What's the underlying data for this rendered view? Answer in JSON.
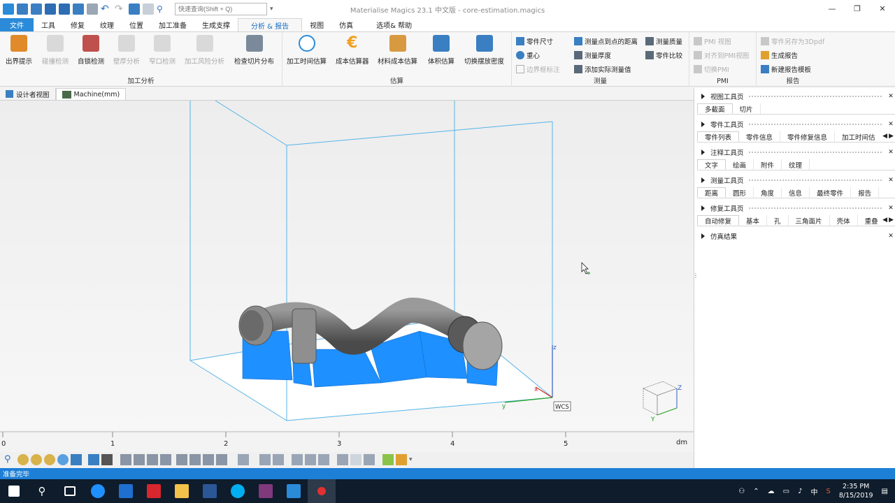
{
  "title": "Materialise Magics 23.1 中文版 - core-estimation.magics",
  "search_placeholder": "快速查询(Shift + Q)",
  "window_controls": [
    "—",
    "❐",
    "✕"
  ],
  "menu_tabs": [
    {
      "label": "文件",
      "kind": "file"
    },
    {
      "label": "工具"
    },
    {
      "label": "修复"
    },
    {
      "label": "纹理"
    },
    {
      "label": "位置"
    },
    {
      "label": "加工准备"
    },
    {
      "label": "生成支撑"
    },
    {
      "label": "分析 & 报告",
      "kind": "active"
    },
    {
      "label": "视图"
    },
    {
      "label": "仿真"
    },
    {
      "label": "选项& 帮助"
    }
  ],
  "ribbon": {
    "groups": [
      {
        "label": "加工分析"
      },
      {
        "label": "估算"
      },
      {
        "label": "测量"
      },
      {
        "label": "PMI"
      },
      {
        "label": "报告"
      }
    ],
    "big_buttons": [
      {
        "label": "出界提示",
        "icon": "out-of-bounds-icon",
        "color": "#e08a2a",
        "enabled": true
      },
      {
        "label": "碰撞检测",
        "icon": "collision-icon",
        "color": "#bdbdbd",
        "enabled": false
      },
      {
        "label": "自锁检测",
        "icon": "self-lock-icon",
        "color": "#c0504d",
        "enabled": true
      },
      {
        "label": "壁厚分析",
        "icon": "wall-thickness-icon",
        "color": "#bdbdbd",
        "enabled": false
      },
      {
        "label": "窄口检测",
        "icon": "narrow-gap-icon",
        "color": "#bdbdbd",
        "enabled": false
      },
      {
        "label": "加工风险分析",
        "icon": "risk-analysis-icon",
        "color": "#bdbdbd",
        "enabled": false
      },
      {
        "label": "检查切片分布",
        "icon": "slice-distribution-icon",
        "color": "#7a8a9a",
        "enabled": true
      },
      {
        "label": "加工时间估算",
        "icon": "clock-icon",
        "color": "#2b8bd9",
        "enabled": true
      },
      {
        "label": "成本估算器",
        "icon": "euro-icon",
        "color": "#f0a020",
        "enabled": true
      },
      {
        "label": "材料成本估算",
        "icon": "material-cost-icon",
        "color": "#d89a40",
        "enabled": true
      },
      {
        "label": "体积估算",
        "icon": "volume-estimate-icon",
        "color": "#3a7fc2",
        "enabled": true
      },
      {
        "label": "切换摆放密度",
        "icon": "packing-density-icon",
        "color": "#3a7fc2",
        "enabled": true
      }
    ],
    "small_buttons": [
      {
        "label": "零件尺寸",
        "icon": "part-dimensions-icon",
        "enabled": true
      },
      {
        "label": "重心",
        "icon": "center-of-gravity-icon",
        "enabled": true
      },
      {
        "label": "边界框标注",
        "icon": "bounding-box-icon",
        "enabled": false
      },
      {
        "label": "测量点到点的距离",
        "icon": "point-distance-icon",
        "enabled": true
      },
      {
        "label": "测量厚度",
        "icon": "thickness-icon",
        "enabled": true
      },
      {
        "label": "添加实际测量值",
        "icon": "add-measurement-icon",
        "enabled": true
      },
      {
        "label": "测量质量",
        "icon": "measure-quality-icon",
        "enabled": true
      },
      {
        "label": "零件比较",
        "icon": "part-compare-icon",
        "enabled": true
      },
      {
        "label": "PMI 视图",
        "icon": "pmi-view-icon",
        "enabled": false
      },
      {
        "label": "对齐到PMI视图",
        "icon": "align-pmi-icon",
        "enabled": false
      },
      {
        "label": "切换PMI",
        "icon": "toggle-pmi-icon",
        "enabled": false
      },
      {
        "label": "零件另存为3Dpdf",
        "icon": "save-3dpdf-icon",
        "enabled": false
      },
      {
        "label": "生成报告",
        "icon": "report-icon",
        "enabled": true
      },
      {
        "label": "新建报告模板",
        "icon": "report-template-icon",
        "enabled": true
      }
    ]
  },
  "doc_tabs": [
    {
      "label": "设计者视图",
      "icon": "designer-view-icon",
      "active": false
    },
    {
      "label": "Machine(mm)",
      "icon": "machine-icon",
      "active": true
    }
  ],
  "viewport": {
    "axis_labels": {
      "z": "z",
      "x": "x",
      "y": "y"
    },
    "wcs_label": "WCS",
    "view_cube_axes": {
      "z": "Z",
      "y": "Y"
    }
  },
  "ruler": {
    "ticks": [
      "0",
      "1",
      "2",
      "3",
      "4",
      "5"
    ],
    "unit": "dm"
  },
  "right_panel": {
    "toolpages": [
      {
        "title": "视图工具页",
        "tabs": [
          "多截面",
          "切片"
        ],
        "active": 0,
        "arrows": false
      },
      {
        "title": "零件工具页",
        "tabs": [
          "零件列表",
          "零件信息",
          "零件修复信息",
          "加工时间估"
        ],
        "active": 0,
        "arrows": true
      },
      {
        "title": "注释工具页",
        "tabs": [
          "文字",
          "绘画",
          "附件",
          "纹理"
        ],
        "active": 0,
        "arrows": false
      },
      {
        "title": "测量工具页",
        "tabs": [
          "距离",
          "圆形",
          "角度",
          "信息",
          "最终零件",
          "报告"
        ],
        "active": 0,
        "arrows": false
      },
      {
        "title": "修复工具页",
        "tabs": [
          "自动修复",
          "基本",
          "孔",
          "三角面片",
          "壳体",
          "重叠"
        ],
        "active": 0,
        "arrows": true
      },
      {
        "title": "仿真结果",
        "tabs": [],
        "active": -1,
        "arrows": false
      }
    ]
  },
  "status": "准备完毕",
  "taskbar": {
    "apps": [
      {
        "icon": "windows-start-icon",
        "color": "#ffffff"
      },
      {
        "icon": "search-icon",
        "color": "#ffffff"
      },
      {
        "icon": "task-view-icon",
        "color": "#ffffff"
      },
      {
        "icon": "edge-icon",
        "color": "#1e90ff"
      },
      {
        "icon": "outlook-icon",
        "color": "#1e6fd0"
      },
      {
        "icon": "youdao-icon",
        "color": "#d8262e"
      },
      {
        "icon": "file-explorer-icon",
        "color": "#f2c24a"
      },
      {
        "icon": "word-icon",
        "color": "#2b5797"
      },
      {
        "icon": "skype-icon",
        "color": "#00aff0"
      },
      {
        "icon": "onenote-icon",
        "color": "#80397b"
      },
      {
        "icon": "magics-taskbar-icon",
        "color": "#2b8bd9"
      },
      {
        "icon": "recorder-icon",
        "color": "#e03030"
      }
    ],
    "ime": "中",
    "time": "2:35 PM",
    "date": "8/15/2019"
  }
}
